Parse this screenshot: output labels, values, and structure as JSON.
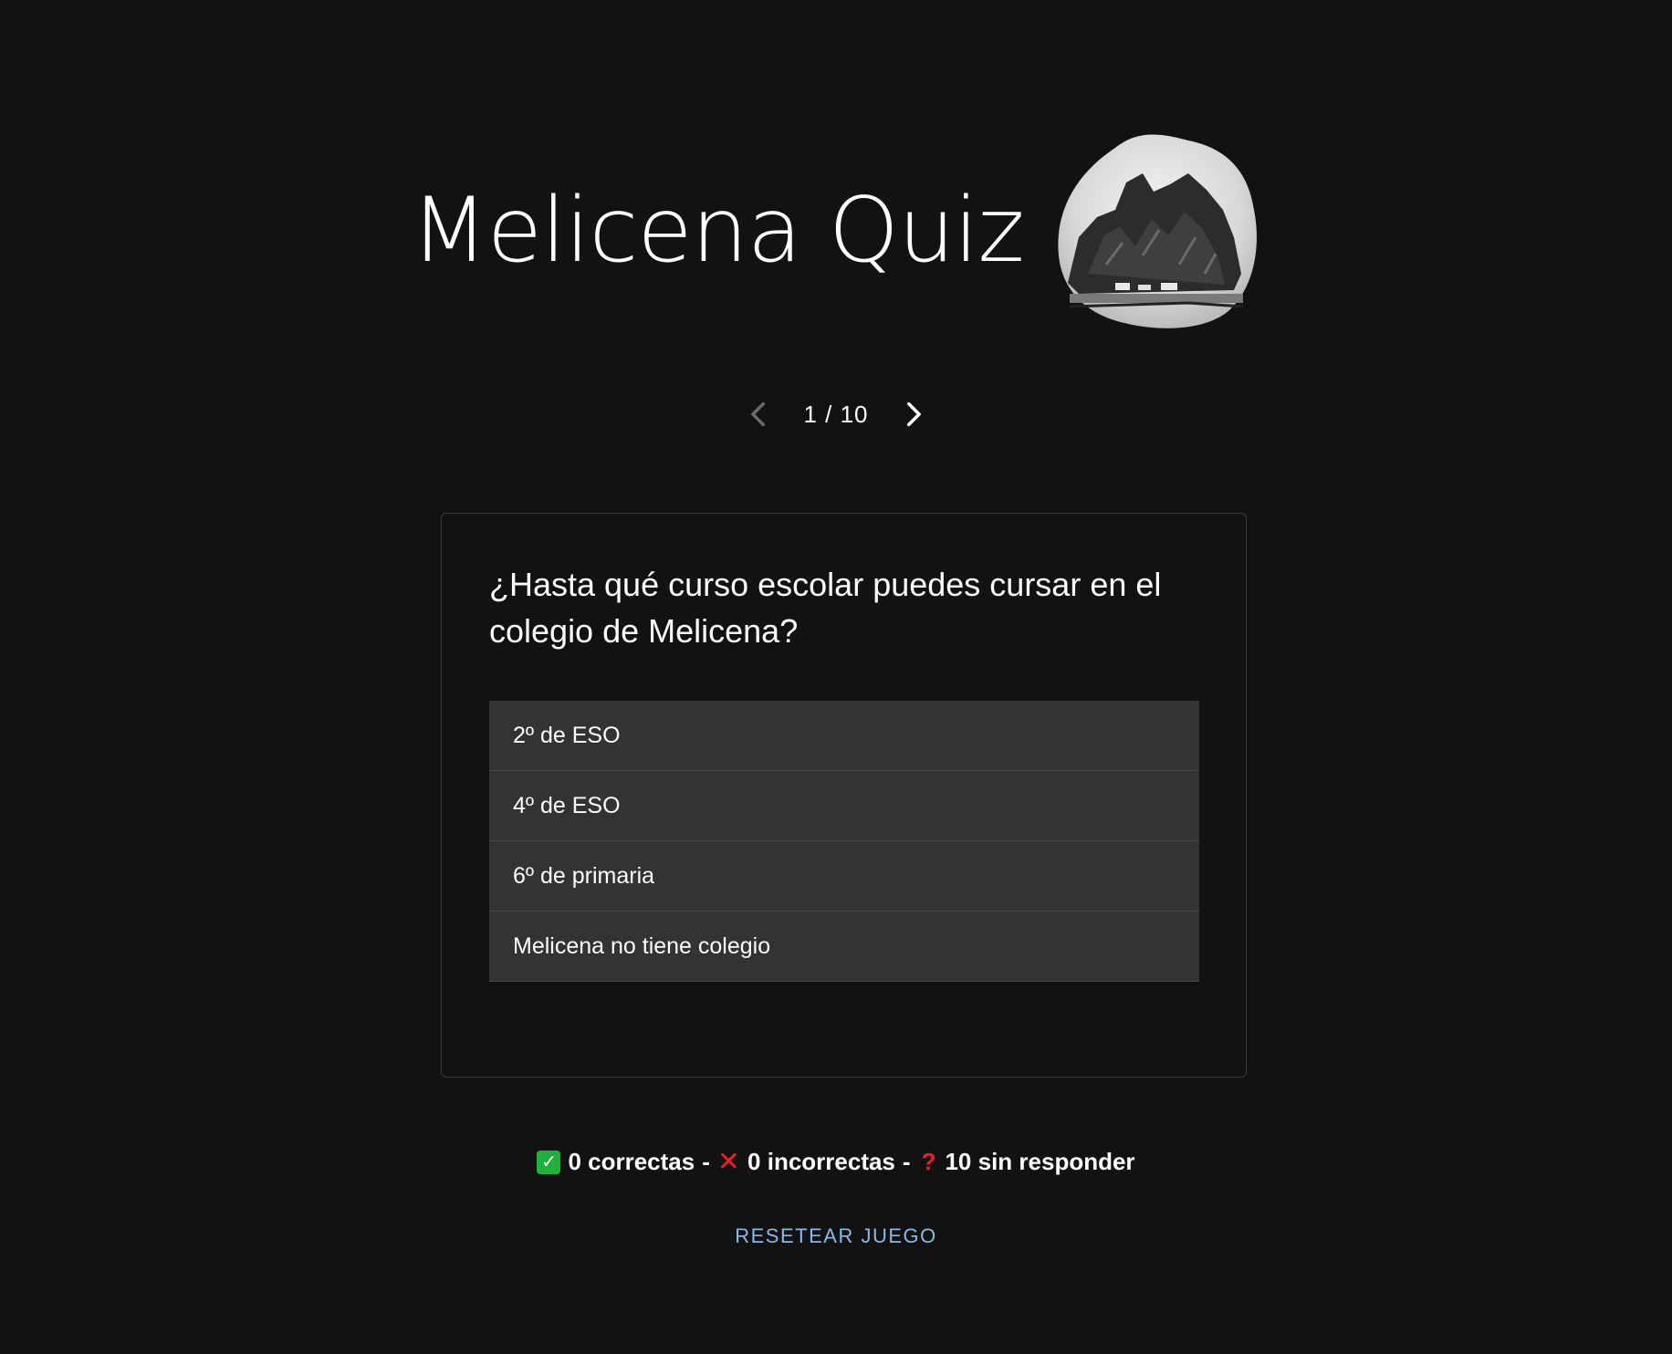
{
  "header": {
    "title": "Melicena Quiz",
    "logo_icon": "melicena-rock-drawing"
  },
  "pager": {
    "prev_icon": "chevron-left-icon",
    "next_icon": "chevron-right-icon",
    "position": "1 / 10",
    "current": 1,
    "total": 10
  },
  "question": {
    "text": "¿Hasta qué curso escolar puedes cursar en el colegio de Melicena?",
    "options": [
      {
        "label": "2º de ESO"
      },
      {
        "label": "4º de ESO"
      },
      {
        "label": "6º de primaria"
      },
      {
        "label": "Melicena no tiene colegio"
      }
    ]
  },
  "score": {
    "correct_icon": "✅",
    "correct_text": "0 correctas",
    "incorrect_icon": "❌",
    "incorrect_text": "0 incorrectas",
    "unanswered_icon": "❓",
    "unanswered_text": "10 sin responder",
    "separator": "-"
  },
  "reset": {
    "label": "RESETEAR JUEGO"
  },
  "colors": {
    "background": "#121212",
    "option_bg": "#333333",
    "accent": "#8cb8e6",
    "correct": "#20b040",
    "incorrect": "#e8202a"
  }
}
